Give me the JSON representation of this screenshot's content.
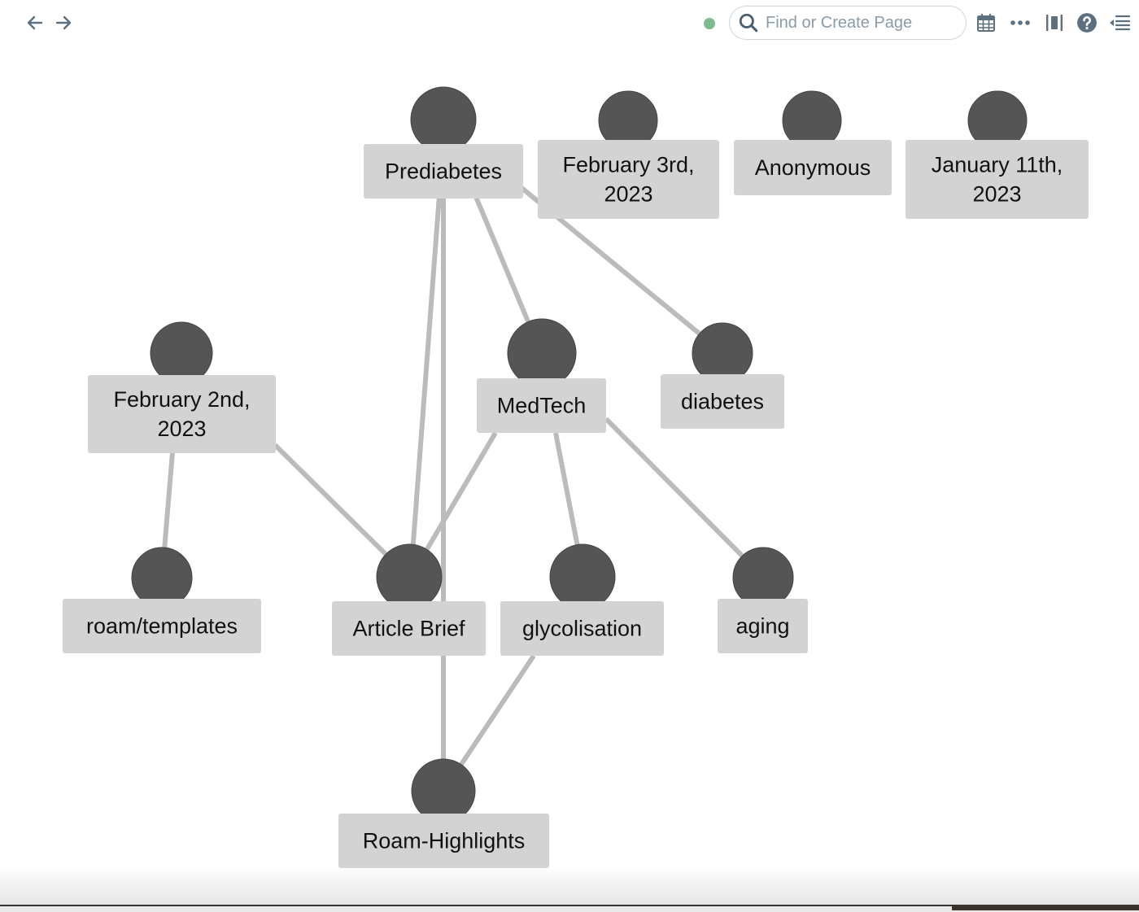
{
  "toolbar": {
    "back_icon": "arrow-left-icon",
    "forward_icon": "arrow-right-icon",
    "sync_status_color": "#7dba8f",
    "search": {
      "placeholder": "Find or Create Page",
      "value": "",
      "icon": "search-icon"
    },
    "icons": [
      "calendar-icon",
      "more-icon",
      "sidebar-toggle-icon",
      "help-icon",
      "right-sidebar-icon"
    ],
    "icon_color": "#5c7080"
  },
  "graph": {
    "colors": {
      "node_circle": "#555555",
      "label_bg": "#d3d3d3",
      "edge": "#bbbbbb",
      "label_text": "#111111"
    },
    "nodes": [
      {
        "id": "prediabetes",
        "lines": [
          "Prediabetes"
        ]
      },
      {
        "id": "feb3",
        "lines": [
          "February 3rd,",
          "2023"
        ]
      },
      {
        "id": "anonymous",
        "lines": [
          "Anonymous"
        ]
      },
      {
        "id": "jan11",
        "lines": [
          "January 11th,",
          "2023"
        ]
      },
      {
        "id": "feb2",
        "lines": [
          "February 2nd,",
          "2023"
        ]
      },
      {
        "id": "medtech",
        "lines": [
          "MedTech"
        ]
      },
      {
        "id": "diabetes",
        "lines": [
          "diabetes"
        ]
      },
      {
        "id": "templates",
        "lines": [
          "roam/templates"
        ]
      },
      {
        "id": "article",
        "lines": [
          "Article Brief"
        ]
      },
      {
        "id": "glycolisation",
        "lines": [
          "glycolisation"
        ]
      },
      {
        "id": "aging",
        "lines": [
          "aging"
        ]
      },
      {
        "id": "highlights",
        "lines": [
          "Roam-Highlights"
        ]
      }
    ],
    "edges": [
      [
        "prediabetes",
        "article"
      ],
      [
        "prediabetes",
        "highlights"
      ],
      [
        "prediabetes",
        "medtech"
      ],
      [
        "prediabetes",
        "diabetes"
      ],
      [
        "feb2",
        "templates"
      ],
      [
        "feb2",
        "article"
      ],
      [
        "medtech",
        "article"
      ],
      [
        "medtech",
        "glycolisation"
      ],
      [
        "medtech",
        "aging"
      ],
      [
        "glycolisation",
        "highlights"
      ]
    ]
  }
}
